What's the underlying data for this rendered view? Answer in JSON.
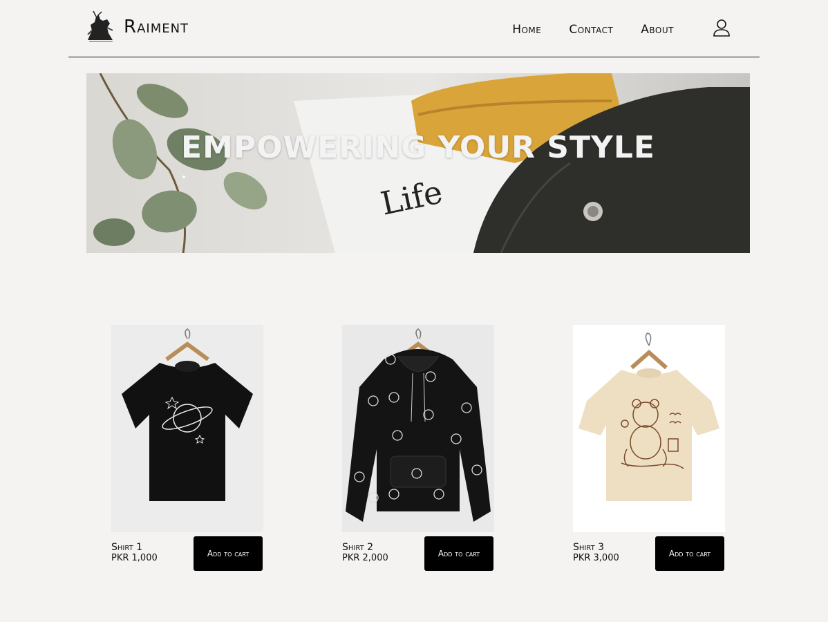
{
  "header": {
    "brand": "Raiment",
    "nav": [
      "Home",
      "Contact",
      "About"
    ]
  },
  "banner": {
    "headline": "EMPOWERING YOUR STYLE",
    "note_text": "Life"
  },
  "products": [
    {
      "name": "Shirt 1",
      "price": "PKR 1,000",
      "button": "Add to cart"
    },
    {
      "name": "Shirt 2",
      "price": "PKR 2,000",
      "button": "Add to cart"
    },
    {
      "name": "Shirt 3",
      "price": "PKR 3,000",
      "button": "Add to cart"
    }
  ],
  "colors": {
    "background": "#f4f3f1",
    "button_bg": "#000000",
    "button_text": "#ffffff"
  }
}
